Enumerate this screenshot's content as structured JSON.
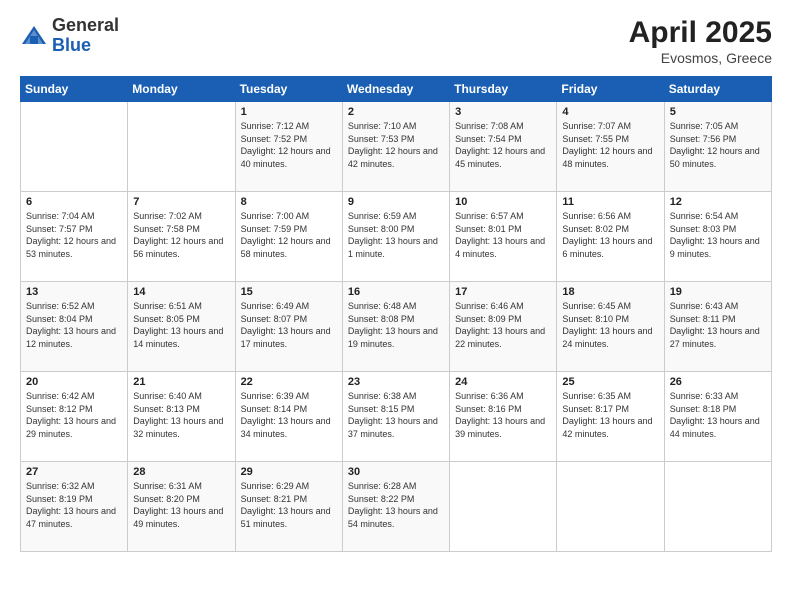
{
  "header": {
    "logo_general": "General",
    "logo_blue": "Blue",
    "title": "April 2025",
    "location": "Evosmos, Greece"
  },
  "days_of_week": [
    "Sunday",
    "Monday",
    "Tuesday",
    "Wednesday",
    "Thursday",
    "Friday",
    "Saturday"
  ],
  "weeks": [
    [
      {
        "num": "",
        "info": ""
      },
      {
        "num": "",
        "info": ""
      },
      {
        "num": "1",
        "info": "Sunrise: 7:12 AM\nSunset: 7:52 PM\nDaylight: 12 hours and 40 minutes."
      },
      {
        "num": "2",
        "info": "Sunrise: 7:10 AM\nSunset: 7:53 PM\nDaylight: 12 hours and 42 minutes."
      },
      {
        "num": "3",
        "info": "Sunrise: 7:08 AM\nSunset: 7:54 PM\nDaylight: 12 hours and 45 minutes."
      },
      {
        "num": "4",
        "info": "Sunrise: 7:07 AM\nSunset: 7:55 PM\nDaylight: 12 hours and 48 minutes."
      },
      {
        "num": "5",
        "info": "Sunrise: 7:05 AM\nSunset: 7:56 PM\nDaylight: 12 hours and 50 minutes."
      }
    ],
    [
      {
        "num": "6",
        "info": "Sunrise: 7:04 AM\nSunset: 7:57 PM\nDaylight: 12 hours and 53 minutes."
      },
      {
        "num": "7",
        "info": "Sunrise: 7:02 AM\nSunset: 7:58 PM\nDaylight: 12 hours and 56 minutes."
      },
      {
        "num": "8",
        "info": "Sunrise: 7:00 AM\nSunset: 7:59 PM\nDaylight: 12 hours and 58 minutes."
      },
      {
        "num": "9",
        "info": "Sunrise: 6:59 AM\nSunset: 8:00 PM\nDaylight: 13 hours and 1 minute."
      },
      {
        "num": "10",
        "info": "Sunrise: 6:57 AM\nSunset: 8:01 PM\nDaylight: 13 hours and 4 minutes."
      },
      {
        "num": "11",
        "info": "Sunrise: 6:56 AM\nSunset: 8:02 PM\nDaylight: 13 hours and 6 minutes."
      },
      {
        "num": "12",
        "info": "Sunrise: 6:54 AM\nSunset: 8:03 PM\nDaylight: 13 hours and 9 minutes."
      }
    ],
    [
      {
        "num": "13",
        "info": "Sunrise: 6:52 AM\nSunset: 8:04 PM\nDaylight: 13 hours and 12 minutes."
      },
      {
        "num": "14",
        "info": "Sunrise: 6:51 AM\nSunset: 8:05 PM\nDaylight: 13 hours and 14 minutes."
      },
      {
        "num": "15",
        "info": "Sunrise: 6:49 AM\nSunset: 8:07 PM\nDaylight: 13 hours and 17 minutes."
      },
      {
        "num": "16",
        "info": "Sunrise: 6:48 AM\nSunset: 8:08 PM\nDaylight: 13 hours and 19 minutes."
      },
      {
        "num": "17",
        "info": "Sunrise: 6:46 AM\nSunset: 8:09 PM\nDaylight: 13 hours and 22 minutes."
      },
      {
        "num": "18",
        "info": "Sunrise: 6:45 AM\nSunset: 8:10 PM\nDaylight: 13 hours and 24 minutes."
      },
      {
        "num": "19",
        "info": "Sunrise: 6:43 AM\nSunset: 8:11 PM\nDaylight: 13 hours and 27 minutes."
      }
    ],
    [
      {
        "num": "20",
        "info": "Sunrise: 6:42 AM\nSunset: 8:12 PM\nDaylight: 13 hours and 29 minutes."
      },
      {
        "num": "21",
        "info": "Sunrise: 6:40 AM\nSunset: 8:13 PM\nDaylight: 13 hours and 32 minutes."
      },
      {
        "num": "22",
        "info": "Sunrise: 6:39 AM\nSunset: 8:14 PM\nDaylight: 13 hours and 34 minutes."
      },
      {
        "num": "23",
        "info": "Sunrise: 6:38 AM\nSunset: 8:15 PM\nDaylight: 13 hours and 37 minutes."
      },
      {
        "num": "24",
        "info": "Sunrise: 6:36 AM\nSunset: 8:16 PM\nDaylight: 13 hours and 39 minutes."
      },
      {
        "num": "25",
        "info": "Sunrise: 6:35 AM\nSunset: 8:17 PM\nDaylight: 13 hours and 42 minutes."
      },
      {
        "num": "26",
        "info": "Sunrise: 6:33 AM\nSunset: 8:18 PM\nDaylight: 13 hours and 44 minutes."
      }
    ],
    [
      {
        "num": "27",
        "info": "Sunrise: 6:32 AM\nSunset: 8:19 PM\nDaylight: 13 hours and 47 minutes."
      },
      {
        "num": "28",
        "info": "Sunrise: 6:31 AM\nSunset: 8:20 PM\nDaylight: 13 hours and 49 minutes."
      },
      {
        "num": "29",
        "info": "Sunrise: 6:29 AM\nSunset: 8:21 PM\nDaylight: 13 hours and 51 minutes."
      },
      {
        "num": "30",
        "info": "Sunrise: 6:28 AM\nSunset: 8:22 PM\nDaylight: 13 hours and 54 minutes."
      },
      {
        "num": "",
        "info": ""
      },
      {
        "num": "",
        "info": ""
      },
      {
        "num": "",
        "info": ""
      }
    ]
  ]
}
